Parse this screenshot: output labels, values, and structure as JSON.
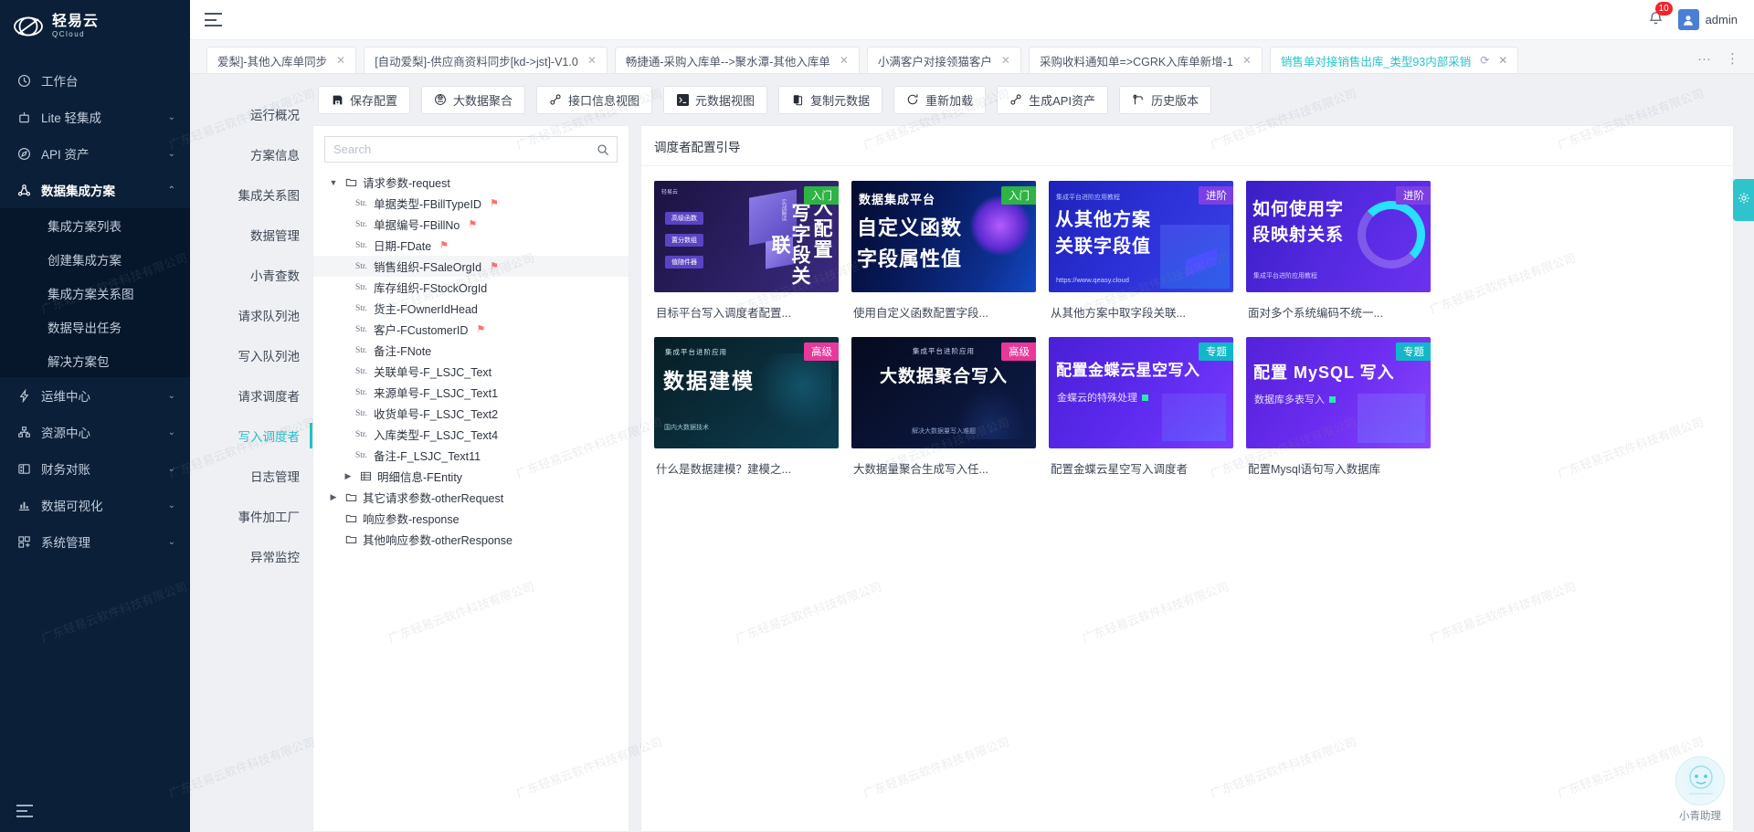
{
  "brand": {
    "name_cn": "轻易云",
    "name_en": "QCloud",
    "accent": "#27c0c8"
  },
  "topbar": {
    "menu_icon": "hamburger-icon",
    "notification_count": "10",
    "user_name": "admin"
  },
  "sidebar": {
    "items": [
      {
        "label": "工作台",
        "icon": "dashboard-icon",
        "expandable": false,
        "active": false
      },
      {
        "label": "Lite 轻集成",
        "icon": "lite-icon",
        "expandable": true,
        "active": false
      },
      {
        "label": "API 资产",
        "icon": "api-icon",
        "expandable": true,
        "active": false
      },
      {
        "label": "数据集成方案",
        "icon": "integration-icon",
        "expandable": true,
        "active": true
      },
      {
        "label": "运维中心",
        "icon": "ops-icon",
        "expandable": true,
        "active": false
      },
      {
        "label": "资源中心",
        "icon": "resource-icon",
        "expandable": true,
        "active": false
      },
      {
        "label": "财务对账",
        "icon": "finance-icon",
        "expandable": true,
        "active": false
      },
      {
        "label": "数据可视化",
        "icon": "chart-icon",
        "expandable": true,
        "active": false
      },
      {
        "label": "系统管理",
        "icon": "system-icon",
        "expandable": true,
        "active": false
      }
    ],
    "sub_items": [
      {
        "label": "集成方案列表"
      },
      {
        "label": "创建集成方案"
      },
      {
        "label": "集成方案关系图"
      },
      {
        "label": "数据导出任务"
      },
      {
        "label": "解决方案包"
      }
    ]
  },
  "tabs": {
    "items": [
      {
        "label": "爱梨]-其他入库单同步",
        "active": false,
        "truncated": true
      },
      {
        "label": "[自动爱梨]-供应商资料同步[kd->jst]-V1.0",
        "active": false
      },
      {
        "label": "畅捷通-采购入库单-->聚水潭-其他入库单",
        "active": false
      },
      {
        "label": "小满客户对接领猫客户",
        "active": false
      },
      {
        "label": "采购收料通知单=>CGRK入库单新增-1",
        "active": false
      },
      {
        "label": "销售单对接销售出库_类型93内部采销",
        "active": true
      }
    ],
    "actions": [
      {
        "name": "more-horizontal-icon",
        "glyph": "···"
      },
      {
        "name": "more-vertical-icon",
        "glyph": "⋮"
      }
    ]
  },
  "subnav": {
    "items": [
      {
        "label": "运行概况",
        "active": false
      },
      {
        "label": "方案信息",
        "active": false
      },
      {
        "label": "集成关系图",
        "active": false
      },
      {
        "label": "数据管理",
        "active": false
      },
      {
        "label": "小青查数",
        "active": false
      },
      {
        "label": "请求队列池",
        "active": false
      },
      {
        "label": "写入队列池",
        "active": false
      },
      {
        "label": "请求调度者",
        "active": false
      },
      {
        "label": "写入调度者",
        "active": true
      },
      {
        "label": "日志管理",
        "active": false
      },
      {
        "label": "事件加工厂",
        "active": false
      },
      {
        "label": "异常监控",
        "active": false
      }
    ]
  },
  "toolbar": {
    "buttons": [
      {
        "label": "保存配置",
        "icon": "save-icon"
      },
      {
        "label": "大数据聚合",
        "icon": "aggregate-icon"
      },
      {
        "label": "接口信息视图",
        "icon": "interface-icon"
      },
      {
        "label": "元数据视图",
        "icon": "terminal-icon"
      },
      {
        "label": "复制元数据",
        "icon": "copy-icon"
      },
      {
        "label": "重新加载",
        "icon": "reload-icon"
      },
      {
        "label": "生成API资产",
        "icon": "api-asset-icon"
      },
      {
        "label": "历史版本",
        "icon": "history-icon"
      }
    ]
  },
  "tree_panel": {
    "search_placeholder": "Search",
    "search_value": "",
    "search_icon": "search-icon",
    "nodes": [
      {
        "level": 0,
        "type": "folder",
        "caret": "▼",
        "label": "请求参数-request",
        "flag": false,
        "selected": false
      },
      {
        "level": 1,
        "type": "str",
        "tag": "Str.",
        "label": "单据类型-FBillTypeID",
        "flag": true,
        "selected": false
      },
      {
        "level": 1,
        "type": "str",
        "tag": "Str.",
        "label": "单据编号-FBillNo",
        "flag": true,
        "selected": false
      },
      {
        "level": 1,
        "type": "str",
        "tag": "Str.",
        "label": "日期-FDate",
        "flag": true,
        "selected": false
      },
      {
        "level": 1,
        "type": "str",
        "tag": "Str.",
        "label": "销售组织-FSaleOrgId",
        "flag": true,
        "selected": true
      },
      {
        "level": 1,
        "type": "str",
        "tag": "Str.",
        "label": "库存组织-FStockOrgId",
        "flag": false,
        "selected": false
      },
      {
        "level": 1,
        "type": "str",
        "tag": "Str.",
        "label": "货主-FOwnerIdHead",
        "flag": false,
        "selected": false
      },
      {
        "level": 1,
        "type": "str",
        "tag": "Str.",
        "label": "客户-FCustomerID",
        "flag": true,
        "selected": false
      },
      {
        "level": 1,
        "type": "str",
        "tag": "Str.",
        "label": "备注-FNote",
        "flag": false,
        "selected": false
      },
      {
        "level": 1,
        "type": "str",
        "tag": "Str.",
        "label": "关联单号-F_LSJC_Text",
        "flag": false,
        "selected": false
      },
      {
        "level": 1,
        "type": "str",
        "tag": "Str.",
        "label": "来源单号-F_LSJC_Text1",
        "flag": false,
        "selected": false
      },
      {
        "level": 1,
        "type": "str",
        "tag": "Str.",
        "label": "收货单号-F_LSJC_Text2",
        "flag": false,
        "selected": false
      },
      {
        "level": 1,
        "type": "str",
        "tag": "Str.",
        "label": "入库类型-F_LSJC_Text4",
        "flag": false,
        "selected": false
      },
      {
        "level": 1,
        "type": "str",
        "tag": "Str.",
        "label": "备注-F_LSJC_Text11",
        "flag": false,
        "selected": false
      },
      {
        "level": 1,
        "type": "table",
        "caret": "▶",
        "label": "明细信息-FEntity",
        "flag": false,
        "selected": false
      },
      {
        "level": 0,
        "type": "folder",
        "caret": "▶",
        "label": "其它请求参数-otherRequest",
        "flag": false,
        "selected": false
      },
      {
        "level": 0,
        "type": "folder",
        "caret": "",
        "label": "响应参数-response",
        "flag": false,
        "selected": false
      },
      {
        "level": 0,
        "type": "folder",
        "caret": "",
        "label": "其他响应参数-otherResponse",
        "flag": false,
        "selected": false
      }
    ]
  },
  "guide": {
    "title": "调度者配置引导",
    "cards": [
      {
        "badge": "入门",
        "badge_type": "entry",
        "headline_a": "写字段关联",
        "headline_b": "入配置",
        "sub": "实战解读",
        "bg": "dark-purple",
        "caption": "目标平台写入调度者配置..."
      },
      {
        "badge": "入门",
        "badge_type": "entry",
        "headline_a": "自定义函数",
        "headline_b": "字段属性值",
        "sub": "数据集成平台",
        "bg": "blue-neon",
        "caption": "使用自定义函数配置字段..."
      },
      {
        "badge": "进阶",
        "badge_type": "adv",
        "headline_a": "从其他方案",
        "headline_b": "关联字段值",
        "sub": "集成平台进阶应用教程",
        "bg": "indigo",
        "caption": "从其他方案中取字段关联..."
      },
      {
        "badge": "进阶",
        "badge_type": "adv",
        "headline_a": "如何使用字",
        "headline_b": "段映射关系",
        "sub": "",
        "bg": "violet",
        "caption": "面对多个系统编码不统一..."
      },
      {
        "badge": "高级",
        "badge_type": "senior",
        "headline_a": "数据建模",
        "headline_b": "",
        "sub": "集成平台进阶应用",
        "bg": "dark-teal",
        "caption": "什么是数据建模？建模之..."
      },
      {
        "badge": "高级",
        "badge_type": "senior",
        "headline_a": "大数据聚合写入",
        "headline_b": "",
        "sub": "集成平台进阶应用",
        "bg": "dark-navy",
        "caption": "大数据量聚合生成写入任..."
      },
      {
        "badge": "专题",
        "badge_type": "topic",
        "headline_a": "配置金蝶云星空写入",
        "headline_b": "",
        "sub": "金蝶云的特殊处理",
        "bg": "purple",
        "caption": "配置金蝶云星空写入调度者"
      },
      {
        "badge": "专题",
        "badge_type": "topic",
        "headline_a": "配置 MySQL 写入",
        "headline_b": "",
        "sub": "数据库多表写入",
        "bg": "purple2",
        "caption": "配置Mysql语句写入数据库"
      }
    ]
  },
  "assistant": {
    "label": "小青助理",
    "icon": "assistant-icon"
  },
  "watermark": {
    "text": "广东轻易云软件科技有限公司"
  }
}
